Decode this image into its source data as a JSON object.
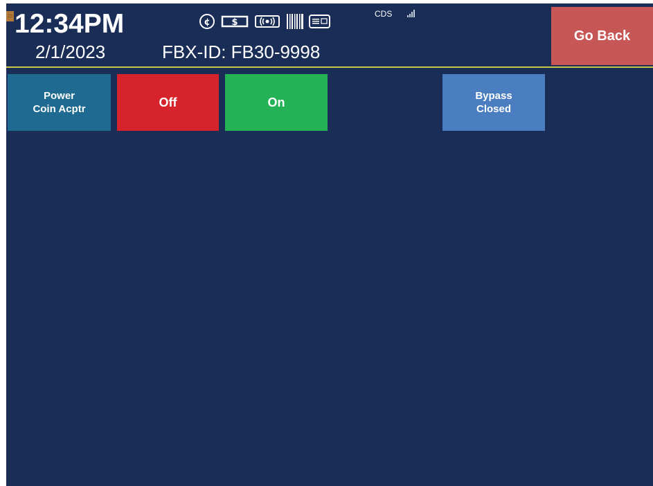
{
  "header": {
    "time": "12:34PM",
    "date": "2/1/2023",
    "fbx_id": "FBX-ID: FB30-9998",
    "network": "CDS",
    "status_icons": [
      "coin-icon",
      "bill-icon",
      "contactless-icon",
      "barcode-icon",
      "card-reader-icon",
      "signal-strength-icon"
    ]
  },
  "actions": {
    "go_back": "Go Back"
  },
  "control_row": {
    "device_label_line1": "Power",
    "device_label_line2": "Coin Acptr",
    "off_label": "Off",
    "on_label": "On",
    "bypass_line1": "Bypass",
    "bypass_line2": "Closed"
  },
  "colors": {
    "background": "#1a2d57",
    "go_back": "#c75756",
    "off": "#d7242c",
    "on": "#25b257",
    "device_label": "#1f6a90",
    "bypass": "#4b7ec0",
    "divider": "#c9c64a"
  }
}
